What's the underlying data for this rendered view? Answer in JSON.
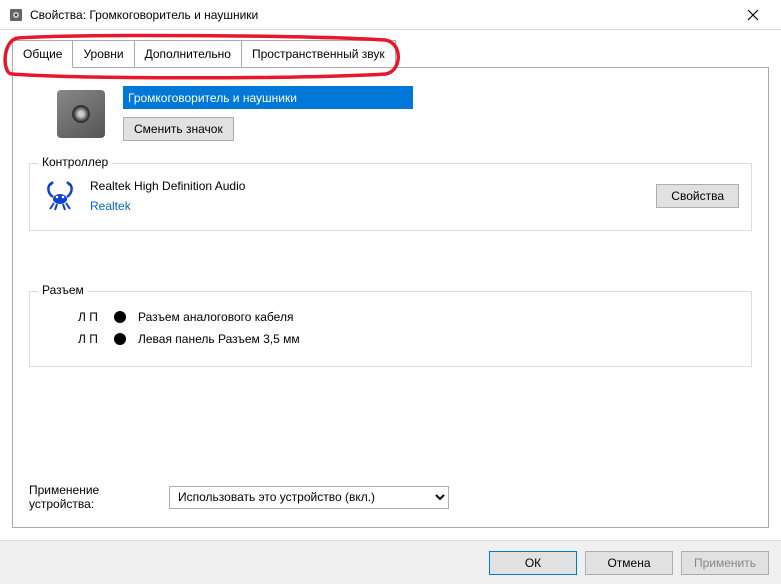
{
  "window": {
    "title": "Свойства: Громкоговоритель и наушники"
  },
  "tabs": [
    {
      "label": "Общие",
      "active": true
    },
    {
      "label": "Уровни",
      "active": false
    },
    {
      "label": "Дополнительно",
      "active": false
    },
    {
      "label": "Пространственный звук",
      "active": false
    }
  ],
  "device": {
    "name": "Громкоговоритель и наушники",
    "change_icon_label": "Сменить значок"
  },
  "controller": {
    "group_title": "Контроллер",
    "name": "Realtek High Definition Audio",
    "vendor": "Realtek",
    "properties_label": "Свойства"
  },
  "jacks": {
    "group_title": "Разъем",
    "items": [
      {
        "lr": "Л П",
        "color": "#000",
        "label": "Разъем аналогового кабеля"
      },
      {
        "lr": "Л П",
        "color": "#000",
        "label": "Левая панель Разъем 3,5 мм"
      }
    ]
  },
  "usage": {
    "label": "Применение устройства:",
    "selected": "Использовать это устройство (вкл.)"
  },
  "footer": {
    "ok": "ОК",
    "cancel": "Отмена",
    "apply": "Применить"
  }
}
